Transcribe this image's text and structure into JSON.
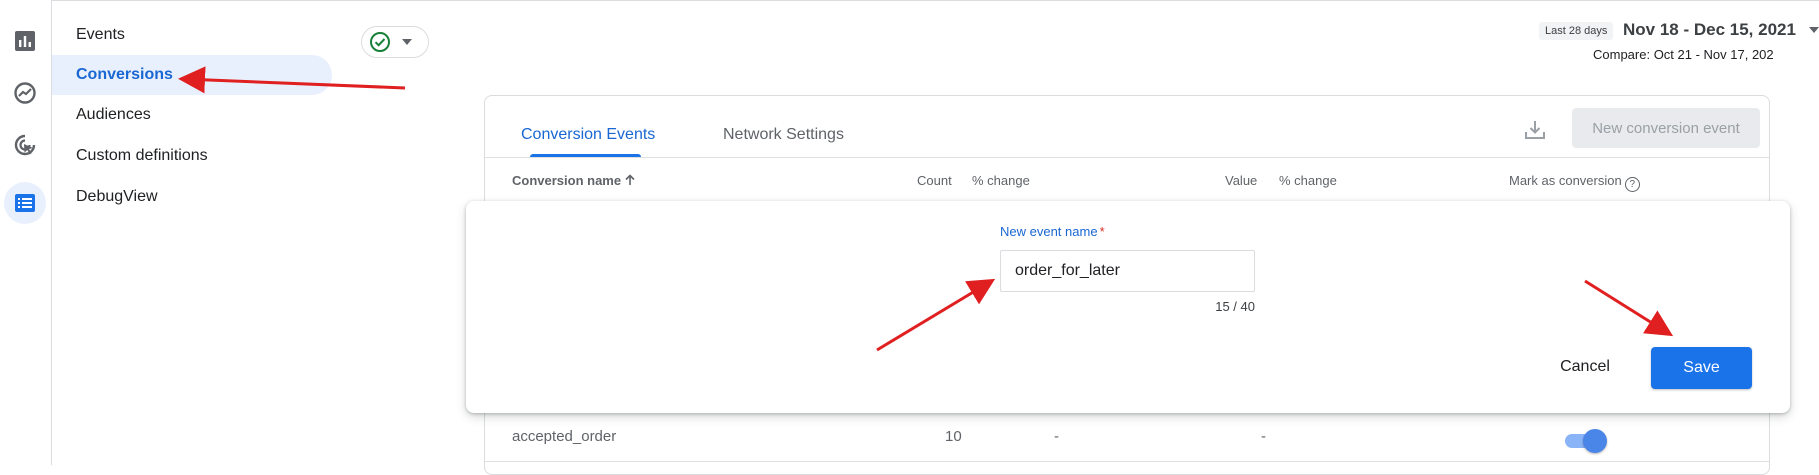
{
  "nav": {
    "items": [
      {
        "label": "Events"
      },
      {
        "label": "Conversions"
      },
      {
        "label": "Audiences"
      },
      {
        "label": "Custom definitions"
      },
      {
        "label": "DebugView"
      }
    ]
  },
  "rail": {
    "icons": [
      "bar-chart-icon",
      "explore-icon",
      "advertising-icon",
      "configure-icon"
    ]
  },
  "status": {
    "icon": "check-circle-icon"
  },
  "date": {
    "chip": "Last 28 days",
    "range": "Nov 18 - Dec 15, 2021",
    "compare": "Compare: Oct 21 - Nov 17, 202"
  },
  "card": {
    "tabs": [
      {
        "label": "Conversion Events"
      },
      {
        "label": "Network Settings"
      }
    ],
    "new_button": "New conversion event",
    "columns": {
      "name": "Conversion name",
      "count": "Count",
      "change1": "% change",
      "value": "Value",
      "change2": "% change",
      "mark": "Mark as conversion",
      "help": "?"
    },
    "row": {
      "name": "accepted_order",
      "count": "10",
      "change1": "-",
      "change2": "-",
      "conversion_on": true
    }
  },
  "dialog": {
    "label": "New event name",
    "required": "*",
    "value": "order_for_later",
    "counter": "15 / 40",
    "cancel": "Cancel",
    "save": "Save"
  },
  "colors": {
    "accent": "#1a73e8",
    "active_text": "#1967d2",
    "active_bg": "#e8f0fe",
    "annotation": "#e02020",
    "success": "#188038"
  }
}
